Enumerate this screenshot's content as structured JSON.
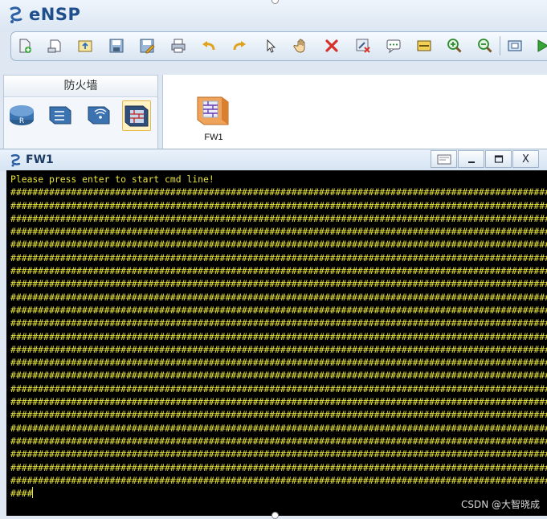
{
  "app": {
    "title": "eNSP",
    "logo_icon": "ensp-logo-icon"
  },
  "toolbar": {
    "buttons": [
      {
        "name": "new-topology-button",
        "icon": "new-file-icon"
      },
      {
        "name": "new-window-button",
        "icon": "new-window-icon"
      },
      {
        "name": "open-button",
        "icon": "open-folder-icon"
      },
      {
        "name": "save-button",
        "icon": "save-icon"
      },
      {
        "name": "save-as-button",
        "icon": "save-as-icon"
      },
      {
        "name": "print-button",
        "icon": "print-icon"
      },
      {
        "name": "undo-button",
        "icon": "undo-icon"
      },
      {
        "name": "redo-button",
        "icon": "redo-icon"
      },
      {
        "name": "select-button",
        "icon": "pointer-icon"
      },
      {
        "name": "pan-button",
        "icon": "hand-icon"
      },
      {
        "name": "delete-button",
        "icon": "delete-icon"
      },
      {
        "name": "delete-link-button",
        "icon": "delete-link-icon"
      },
      {
        "name": "text-note-button",
        "icon": "text-note-icon"
      },
      {
        "name": "rectangle-button",
        "icon": "rectangle-icon"
      },
      {
        "name": "zoom-in-button",
        "icon": "zoom-in-icon"
      },
      {
        "name": "zoom-out-button",
        "icon": "zoom-out-icon"
      },
      {
        "name": "fit-button",
        "icon": "fit-view-icon"
      },
      {
        "name": "start-button",
        "icon": "play-icon"
      }
    ]
  },
  "device_panel": {
    "title": "防火墙",
    "devices": [
      {
        "name": "router-device",
        "icon": "router-icon",
        "selected": false
      },
      {
        "name": "switch-device",
        "icon": "switch-icon",
        "selected": false
      },
      {
        "name": "wireless-device",
        "icon": "wireless-icon",
        "selected": false
      },
      {
        "name": "firewall-device",
        "icon": "firewall-icon",
        "selected": true
      }
    ]
  },
  "canvas": {
    "nodes": [
      {
        "label": "FW1",
        "icon": "firewall-icon"
      }
    ]
  },
  "console": {
    "title": "FW1",
    "buttons": [
      "settings",
      "minimize",
      "maximize",
      "close"
    ],
    "close_label": "X",
    "first_line": "Please press enter to start cmd line!",
    "hash_line": "########################################################################################################",
    "hash_line_count": 23,
    "last_line": "####",
    "colors": {
      "background": "#000000",
      "text": "#e8e43c"
    }
  },
  "watermark": "CSDN @大智晓成"
}
